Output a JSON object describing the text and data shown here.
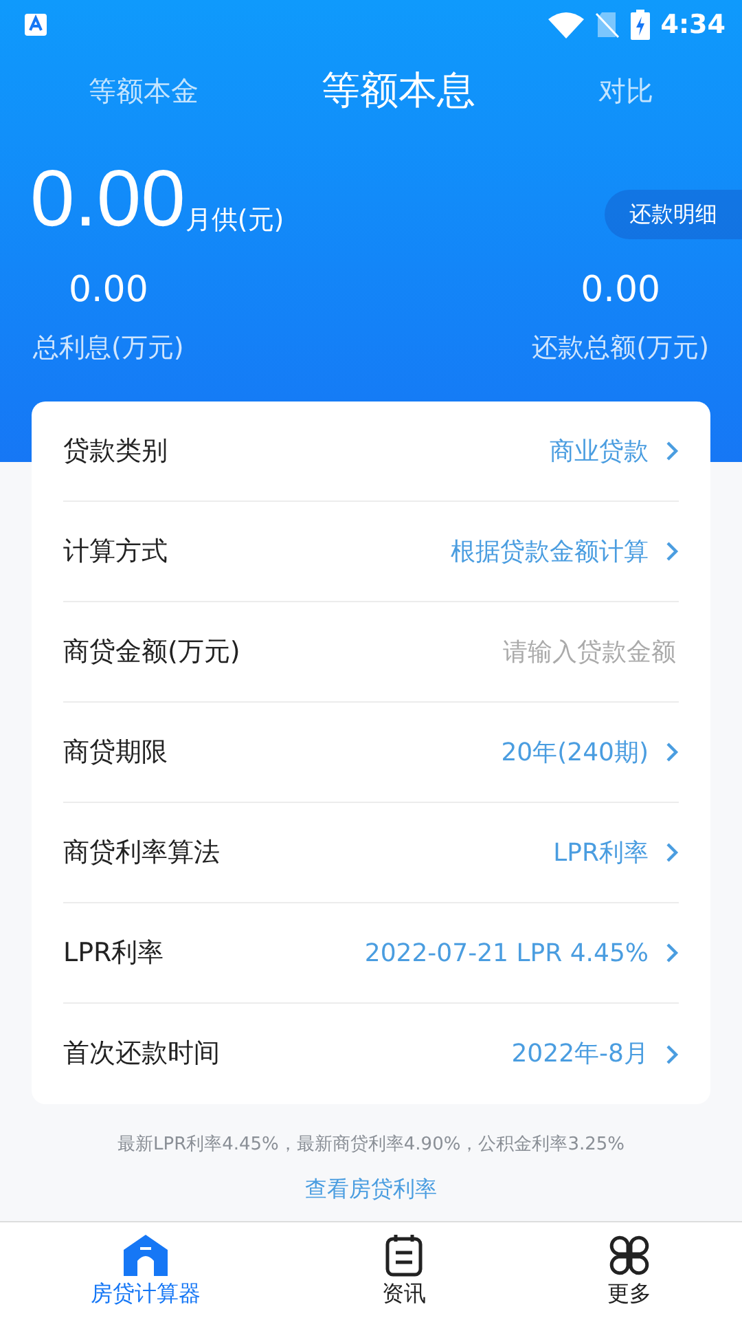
{
  "status_bar": {
    "time": "4:34"
  },
  "tabs": [
    {
      "label": "等额本金",
      "selected": false
    },
    {
      "label": "等额本息",
      "selected": true
    },
    {
      "label": "对比",
      "selected": false
    }
  ],
  "summary": {
    "monthly": "0.00",
    "monthly_label": "月供(元)",
    "detail_button": "还款明细",
    "interest": "0.00",
    "interest_label": "总利息(万元)",
    "total": "0.00",
    "total_label": "还款总额(万元)"
  },
  "form_rows": [
    {
      "kind": "select",
      "label": "贷款类别",
      "value": "商业贷款"
    },
    {
      "kind": "select",
      "label": "计算方式",
      "value": "根据贷款金额计算"
    },
    {
      "kind": "input",
      "label": "商贷金额(万元)",
      "placeholder": "请输入贷款金额"
    },
    {
      "kind": "select",
      "label": "商贷期限",
      "value": "20年(240期)"
    },
    {
      "kind": "select",
      "label": "商贷利率算法",
      "value": "LPR利率"
    },
    {
      "kind": "select",
      "label": "LPR利率",
      "value": "2022-07-21 LPR 4.45%"
    },
    {
      "kind": "select",
      "label": "首次还款时间",
      "value": "2022年-8月"
    }
  ],
  "note": "最新LPR利率4.45%，最新商贷利率4.90%，公积金利率3.25%",
  "rates_link": "查看房贷利率",
  "bottom_nav": [
    {
      "label": "房贷计算器",
      "selected": true
    },
    {
      "label": "资讯",
      "selected": false
    },
    {
      "label": "更多",
      "selected": false
    }
  ]
}
